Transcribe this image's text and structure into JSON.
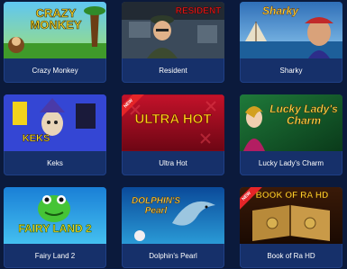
{
  "games": [
    {
      "name": "Crazy Monkey",
      "thumb_text": "CRAZY MONKEY",
      "is_new": false
    },
    {
      "name": "Resident",
      "thumb_text": "RESIDENT",
      "is_new": false
    },
    {
      "name": "Sharky",
      "thumb_text": "Sharky",
      "is_new": false
    },
    {
      "name": "Keks",
      "thumb_text": "KEKS",
      "is_new": false
    },
    {
      "name": "Ultra Hot",
      "thumb_text": "ULTRA HOT",
      "is_new": true
    },
    {
      "name": "Lucky Lady's Charm",
      "thumb_text": "Lucky Lady's Charm",
      "is_new": false
    },
    {
      "name": "Fairy Land 2",
      "thumb_text": "FAIRY LAND 2",
      "is_new": false
    },
    {
      "name": "Dolphin's Pearl",
      "thumb_text": "DOLPHIN'S Pearl",
      "is_new": false
    },
    {
      "name": "Book of Ra HD",
      "thumb_text": "BOOK OF RA HD",
      "is_new": true
    }
  ],
  "badge": {
    "new_label": "NEW"
  },
  "colors": {
    "page_bg": "#0b1a3c",
    "card_bg": "#16306a",
    "label_text": "#ffffff",
    "new_badge": "#e52528"
  }
}
